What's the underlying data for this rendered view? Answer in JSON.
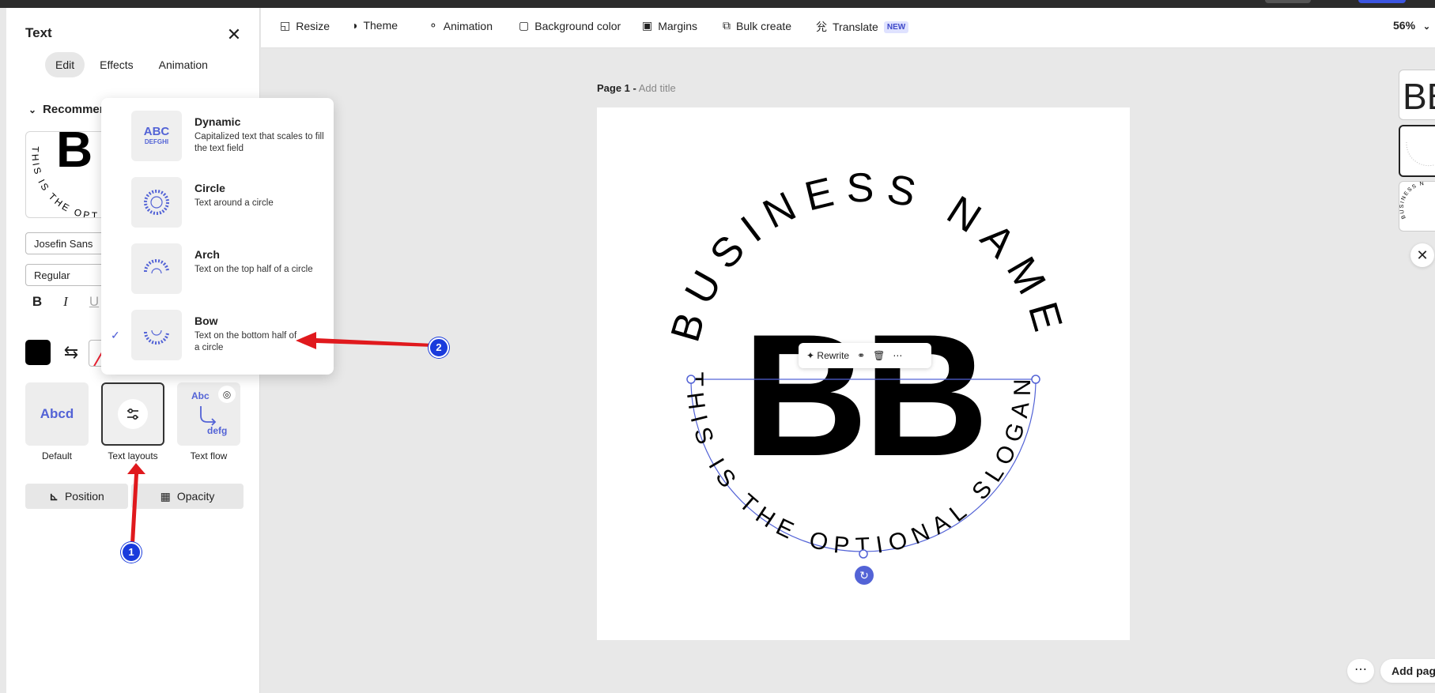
{
  "panel": {
    "title": "Text",
    "tabs": [
      "Edit",
      "Effects",
      "Animation"
    ],
    "active_tab": "Edit",
    "section": "Recommended",
    "preview_letter": "B",
    "preview_arc": "THIS IS THE OPT",
    "font_family": "Josefin Sans",
    "font_weight": "Regular",
    "format": {
      "bold": "B",
      "italic": "I",
      "underline": "U"
    },
    "text_color": "#000000",
    "layouts": [
      {
        "label": "Default",
        "sample": "Abcd"
      },
      {
        "label": "Text layouts"
      },
      {
        "label": "Text flow",
        "sample_top": "Abc",
        "sample_bottom": "defg"
      }
    ],
    "position_label": "Position",
    "opacity_label": "Opacity"
  },
  "dropdown": {
    "items": [
      {
        "name": "Dynamic",
        "desc": "Capitalized text that scales to fill the text field",
        "thumb_top": "ABC",
        "thumb_bottom": "DEFGHI",
        "selected": false
      },
      {
        "name": "Circle",
        "desc": "Text around a circle",
        "selected": false
      },
      {
        "name": "Arch",
        "desc": "Text on the top half of a circle",
        "selected": false
      },
      {
        "name": "Bow",
        "desc": "Text on the bottom half of a circle",
        "selected": true
      }
    ]
  },
  "toolbar": {
    "items": [
      "Resize",
      "Theme",
      "Animation",
      "Background color",
      "Margins",
      "Bulk create",
      "Translate"
    ],
    "new_badge": "NEW",
    "zoom": "56%"
  },
  "canvas": {
    "page_label": "Page 1 -",
    "add_title": "Add title",
    "top_arc": "BUSINESS NAME",
    "monogram": "BB",
    "bottom_arc": "THIS IS THE OPTIONAL SLOGAN",
    "rewrite_label": "Rewrite"
  },
  "thumbs": {
    "first": "BB",
    "third": "BUSINESS N"
  },
  "add_page": "Add page",
  "annotations": [
    "1",
    "2"
  ],
  "colors": {
    "accent": "#5363d6",
    "arrow": "#e0191d",
    "badge": "#1a3bdc"
  }
}
